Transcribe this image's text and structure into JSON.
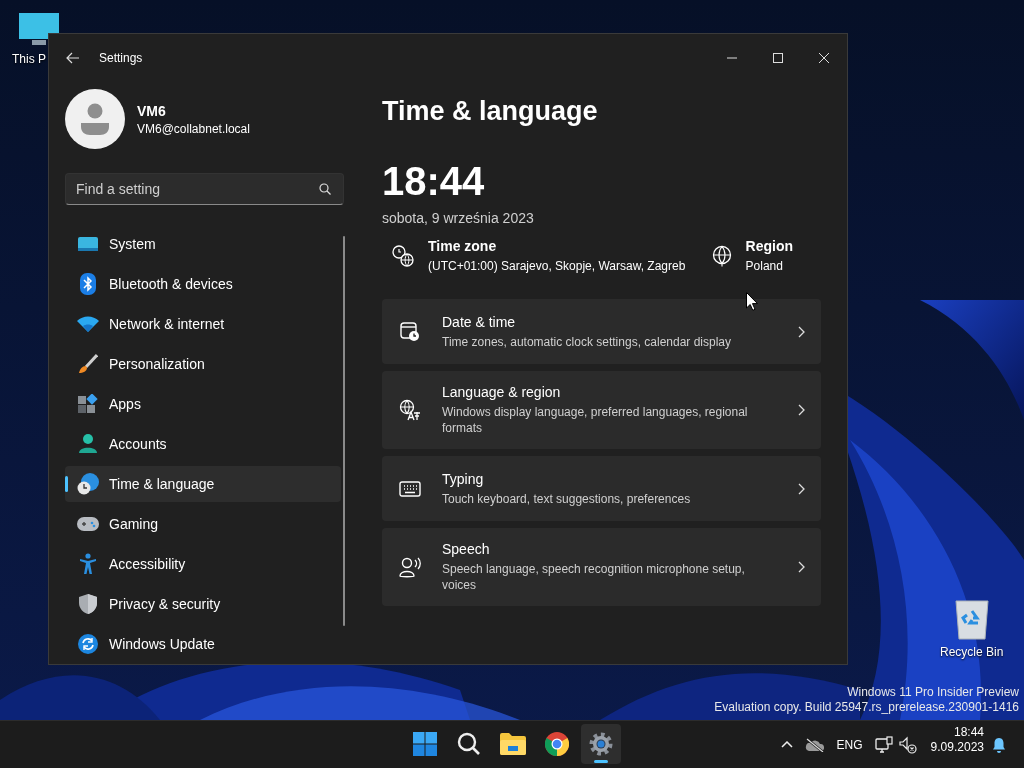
{
  "desktop": {
    "icons": [
      {
        "label": "This P"
      },
      {
        "label": "Recycle Bin"
      }
    ],
    "watermark": [
      "Windows 11 Pro Insider Preview",
      "Evaluation copy. Build 25947.rs_prerelease.230901-1416"
    ]
  },
  "window": {
    "title": "Settings"
  },
  "account": {
    "name": "VM6",
    "email": "VM6@collabnet.local"
  },
  "search": {
    "placeholder": "Find a setting"
  },
  "sidebar": {
    "items": [
      {
        "label": "System",
        "selected": false
      },
      {
        "label": "Bluetooth & devices",
        "selected": false
      },
      {
        "label": "Network & internet",
        "selected": false
      },
      {
        "label": "Personalization",
        "selected": false
      },
      {
        "label": "Apps",
        "selected": false
      },
      {
        "label": "Accounts",
        "selected": false
      },
      {
        "label": "Time & language",
        "selected": true
      },
      {
        "label": "Gaming",
        "selected": false
      },
      {
        "label": "Accessibility",
        "selected": false
      },
      {
        "label": "Privacy & security",
        "selected": false
      },
      {
        "label": "Windows Update",
        "selected": false
      }
    ]
  },
  "page": {
    "title": "Time & language",
    "clock": "18:44",
    "date": "sobota, 9 września 2023",
    "time_zone": {
      "label": "Time zone",
      "value": "(UTC+01:00) Sarajevo, Skopje, Warsaw, Zagreb"
    },
    "region": {
      "label": "Region",
      "value": "Poland"
    },
    "cards": [
      {
        "title": "Date & time",
        "description": "Time zones, automatic clock settings, calendar display"
      },
      {
        "title": "Language & region",
        "description": "Windows display language, preferred languages, regional formats"
      },
      {
        "title": "Typing",
        "description": "Touch keyboard, text suggestions, preferences"
      },
      {
        "title": "Speech",
        "description": "Speech language, speech recognition microphone setup, voices"
      }
    ]
  },
  "taskbar": {
    "apps": [
      {
        "selected": false
      },
      {
        "selected": false
      },
      {
        "selected": false
      },
      {
        "selected": false
      },
      {
        "selected": true
      }
    ],
    "tray": {
      "language": "ENG",
      "time": "18:44",
      "date": "9.09.2023"
    }
  }
}
